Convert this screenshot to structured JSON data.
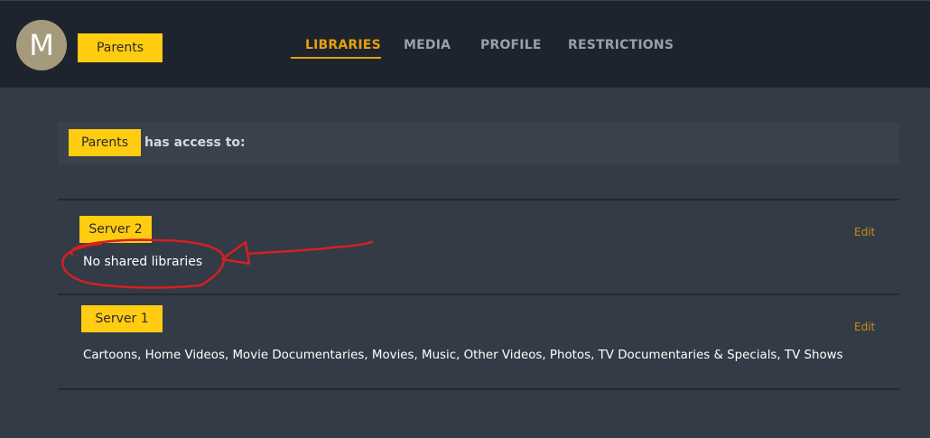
{
  "user": {
    "avatar_letter": "M",
    "name": "Parents"
  },
  "tabs": [
    {
      "label": "LIBRARIES",
      "active": true
    },
    {
      "label": "MEDIA",
      "active": false
    },
    {
      "label": "PROFILE",
      "active": false
    },
    {
      "label": "RESTRICTIONS",
      "active": false
    }
  ],
  "access": {
    "user_label": "Parents",
    "text": "has access to:"
  },
  "servers": [
    {
      "name": "Server 2",
      "edit_label": "Edit",
      "libraries": "No shared libraries"
    },
    {
      "name": "Server 1",
      "edit_label": "Edit",
      "libraries": "Cartoons, Home Videos, Movie Documentaries, Movies, Music, Other Videos, Photos, TV Documentaries & Specials, TV Shows"
    }
  ],
  "colors": {
    "accent": "#e5a00d",
    "label_yellow": "#ffcc11",
    "header_bg": "#1e242d",
    "page_bg": "#333b46",
    "annotation_red": "#d42020"
  }
}
